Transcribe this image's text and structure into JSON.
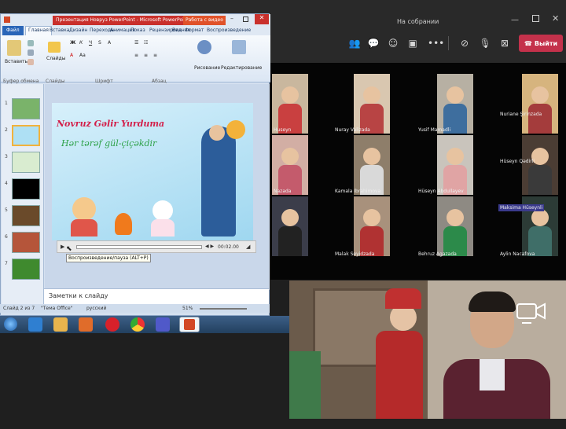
{
  "teams": {
    "window_title": "На собрании",
    "leave_label": "Выйти",
    "toolbar_icons": [
      "people-icon",
      "chat-icon",
      "reactions-icon",
      "rooms-icon",
      "more-icon",
      "camera-off-icon",
      "mic-icon",
      "share-stop-icon"
    ]
  },
  "participants": [
    {
      "name": "Huseyn"
    },
    {
      "name": "Nuray Valizada"
    },
    {
      "name": "Yusif Mamadli"
    },
    {
      "name": "Nuriane Şirinzada"
    },
    {
      "name": "Hüseyn Qədirli"
    },
    {
      "name": "Nazada"
    },
    {
      "name": "Kamala Ibrahimova"
    },
    {
      "name": "Hüseyn Abdullayev"
    },
    {
      "name": "Maksima Hüseynli"
    },
    {
      "name": "Malak Seyidzada"
    },
    {
      "name": "Behruz Agazada"
    },
    {
      "name": "Aylin Nacafova"
    }
  ],
  "ppt": {
    "title": "Презентация Новруз PowerPoint - Microsoft PowerPoint",
    "context_tab": "Работа с видео",
    "tabs": [
      "Файл",
      "Главная",
      "Вставка",
      "Дизайн",
      "Переходы",
      "Анимация",
      "Показ",
      "Рецензирование",
      "Вид",
      "Формат",
      "Воспроизведение"
    ],
    "groups": {
      "clipboard": "Буфер обмена",
      "slides": "Слайды",
      "font": "Шрифт",
      "paragraph": "Абзац",
      "drawing": "Рисование",
      "editing": "Редактирование"
    },
    "paste_label": "Вставить",
    "slides_label": "Слайды",
    "slide_text_1": "Novruz Gəlir Yurduma",
    "slide_text_2": "Hər tərəf gül-çiçəkdir",
    "tooltip": "Воспроизведение/пауза (ALT+P)",
    "video_time": "00:02.00",
    "notes": "Заметки к слайду",
    "status_slide": "Слайд 2 из 7",
    "status_theme": "\"Тема Office\"",
    "status_lang": "русский",
    "zoom": "51%"
  },
  "thumbnails": [
    1,
    2,
    3,
    4,
    5,
    6,
    7
  ],
  "taskbar_apps": [
    "start-button",
    "ie-icon",
    "explorer-icon",
    "media-icon",
    "opera-icon",
    "chrome-icon",
    "teams-icon",
    "powerpoint-icon"
  ],
  "colors": {
    "leave": "#c4314b",
    "teams_bar": "#292929",
    "ppt_title": "#c9302c"
  }
}
